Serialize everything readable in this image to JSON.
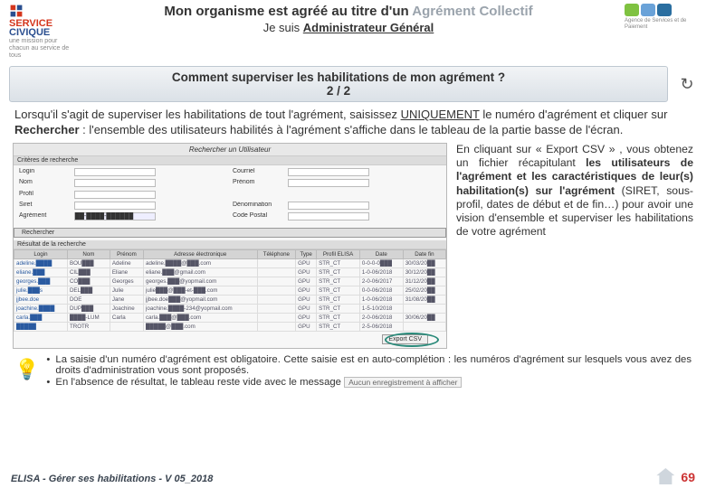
{
  "header": {
    "logo_sc_line1": "SERVICE",
    "logo_sc_line2": "CIVIQUE",
    "logo_sc_tag": "une mission pour chacun au service de tous",
    "title_plain": "Mon organisme est agréé au titre d'un ",
    "title_grey": "Agrément Collectif",
    "subtitle_pre": "Je suis ",
    "subtitle_u": "Administrateur Général",
    "asp_text": "Agence de Services et de Paiement"
  },
  "banner": {
    "q": "Comment superviser les habilitations de mon agrément ?",
    "page": "2 / 2",
    "refresh_icon": "↻"
  },
  "intro": "Lorsqu'il s'agit de superviser les habilitations de tout l'agrément, saisissez UNIQUEMENT le numéro d'agrément et cliquer sur Rechercher : l'ensemble des utilisateurs habilités à l'agrément s'affiche dans le tableau de la partie basse de l'écran.",
  "shot": {
    "title": "Rechercher un Utilisateur",
    "section1": "Critères de recherche",
    "labels": {
      "login": "Login",
      "nom": "Nom",
      "courriel": "Courriel",
      "prenom": "Prénom",
      "profil": "Profil",
      "siret": "Siret",
      "agrement": "Agrément",
      "denomination": "Dénomination",
      "code_postal": "Code Postal"
    },
    "agrement_val": "██-████-██████",
    "btn": "Rechercher",
    "section2": "Résultat de la recherche",
    "cols": [
      "Login",
      "Nom",
      "Prénom",
      "Adresse électronique",
      "Téléphone",
      "Type",
      "Profil ELISA",
      "Date",
      "Date fin"
    ],
    "rows": [
      [
        "adeline.████",
        "BOU███",
        "Adeline",
        "adeline.████@███.com",
        "",
        "GPU",
        "STR_CT",
        "0-0-0-0███",
        "30/03/20██"
      ],
      [
        "eliane.███",
        "CIL███",
        "Eliane",
        "eliane.███@gmail.com",
        "",
        "GPU",
        "STR_CT",
        "1-0-06/2018",
        "30/12/20██"
      ],
      [
        "georges.███",
        "CO███",
        "Georges",
        "georges.███@yopmail.com",
        "",
        "GPU",
        "STR_CT",
        "2-0-06/2017",
        "31/12/20██"
      ],
      [
        "julie.███s",
        "DEL███",
        "Julie",
        "julie███@███-et-███.com",
        "",
        "GPU",
        "STR_CT",
        "0-0-06/2018",
        "25/02/20██"
      ],
      [
        "jjbee.doe",
        "DOE",
        "Jane",
        "jjbee.doe███@yopmail.com",
        "",
        "GPU",
        "STR_CT",
        "1-0-06/2018",
        "31/08/20██"
      ],
      [
        "joachine.████",
        "DUP███",
        "Joachine",
        "joachine.████-234@yopmail.com",
        "",
        "GPU",
        "STR_CT",
        "1-5-10/2018",
        ""
      ],
      [
        "carla.███",
        "████-LUM",
        "Carla",
        "carla.███@███.com",
        "",
        "GPU",
        "STR_CT",
        "2-0-06/2018",
        "30/06/20██"
      ],
      [
        "█████",
        "TROTR",
        "",
        "█████@███.com",
        "",
        "GPU",
        "STR_CT",
        "2-5-06/2018",
        ""
      ]
    ],
    "export": "Export CSV"
  },
  "side": "En cliquant sur « Export CSV » , vous obtenez un fichier récapitulant les utilisateurs de l'agrément et les caractéristiques de leur(s) habilitation(s) sur l'agrément (SIRET, sous-profil, dates de début et de fin…) pour avoir une vision d'ensemble et superviser les habilitations de votre agrément",
  "notes": {
    "n1": "La saisie d'un numéro d'agrément est obligatoire. Cette saisie est en auto-complétion : les numéros d'agrément sur lesquels vous avez des droits d'administration vous sont proposés.",
    "n2_pre": "En l'absence de résultat, le tableau reste vide avec le message ",
    "n2_box": "Aucun enregistrement à afficher"
  },
  "footer": {
    "left": "ELISA - Gérer ses habilitations - V 05_2018",
    "page": "69"
  }
}
